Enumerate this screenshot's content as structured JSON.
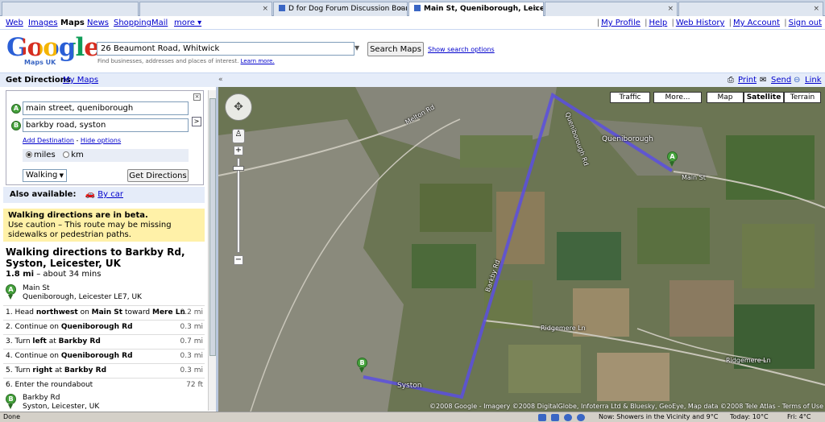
{
  "browser": {
    "tabs": [
      {
        "label": ""
      },
      {
        "label": ""
      },
      {
        "label": "D for Dog Forum Discussion Boar..."
      },
      {
        "label": "Main St, Queniborough, Leicest..."
      },
      {
        "label": ""
      },
      {
        "label": ""
      }
    ],
    "close_glyph": "×"
  },
  "gbar": {
    "left": [
      "Web",
      "Images",
      "Maps",
      "News",
      "Shopping",
      "Mail",
      "more ▾"
    ],
    "active": "Maps",
    "right": [
      "My Profile",
      "Help",
      "Web History",
      "My Account",
      "Sign out"
    ]
  },
  "header": {
    "logo_text": "Google",
    "logo_sub": "Maps UK",
    "search_value": "26 Beaumont Road, Whitwick",
    "search_button": "Search Maps",
    "show_options": "Show search options",
    "hint": "Find businesses, addresses and places of interest.",
    "hint_link": "Learn more."
  },
  "dirbar": {
    "title": "Get Directions",
    "my_maps": "My Maps",
    "collapse": "«",
    "print": "Print",
    "send": "Send",
    "link": "Link"
  },
  "directions": {
    "from_marker": "A",
    "to_marker": "B",
    "from_value": "main street, queniborough",
    "to_value": "barkby road, syston",
    "add_destination": "Add Destination",
    "separator": " - ",
    "hide_options": "Hide options",
    "unit_miles": "miles",
    "unit_km": "km",
    "mode": "Walking",
    "get_button": "Get Directions",
    "reverse": ">",
    "close": "×"
  },
  "also": {
    "label": "Also available:",
    "by_car": "By car"
  },
  "warning": {
    "title": "Walking directions are in beta.",
    "body": "Use caution – This route may be missing sidewalks or pedestrian paths."
  },
  "route": {
    "title": "Walking directions to Barkby Rd, Syston, Leicester, UK",
    "distance": "1.8 mi",
    "duration": " – about 34 mins",
    "start_line1": "Main St",
    "start_line2": "Queniborough, Leicester LE7, UK",
    "end_line1": "Barkby Rd",
    "end_line2": "Syston, Leicester, UK"
  },
  "steps": [
    {
      "n": "1.",
      "pre": "Head ",
      "b1": "northwest",
      "mid": " on ",
      "b2": "Main St",
      "post": " toward ",
      "b3": "Mere Ln",
      "dist": "0.2 mi"
    },
    {
      "n": "2.",
      "pre": "Continue on ",
      "b1": "Queniborough Rd",
      "mid": "",
      "b2": "",
      "post": "",
      "b3": "",
      "dist": "0.3 mi"
    },
    {
      "n": "3.",
      "pre": "Turn ",
      "b1": "left",
      "mid": " at ",
      "b2": "Barkby Rd",
      "post": "",
      "b3": "",
      "dist": "0.7 mi"
    },
    {
      "n": "4.",
      "pre": "Continue on ",
      "b1": "Queniborough Rd",
      "mid": "",
      "b2": "",
      "post": "",
      "b3": "",
      "dist": "0.3 mi"
    },
    {
      "n": "5.",
      "pre": "Turn ",
      "b1": "right",
      "mid": " at ",
      "b2": "Barkby Rd",
      "post": "",
      "b3": "",
      "dist": "0.3 mi"
    },
    {
      "n": "6.",
      "pre": "Enter the roundabout",
      "b1": "",
      "mid": "",
      "b2": "",
      "post": "",
      "b3": "",
      "dist": "72 ft"
    }
  ],
  "map": {
    "buttons": [
      "Traffic",
      "More...",
      "Map",
      "Satellite",
      "Terrain"
    ],
    "selected": "Satellite",
    "labels": {
      "queniborough": "Queniborough",
      "syston": "Syston",
      "barkby": "Barkby Rd",
      "ridgemere": "Ridgemere Ln",
      "ridgemere2": "Ridgemere Ln",
      "main_st": "Main St",
      "queniborough_rd": "Queniborough Rd",
      "melton_rd": "Melton Rd"
    },
    "copyright": "©2008 Google - Imagery ©2008 DigitalGlobe, Infoterra Ltd & Bluesky, GeoEye, Map data ©2008 Tele Atlas - Terms of Use",
    "route_color": "#5b4fe0"
  },
  "status": {
    "done": "Done",
    "weather": "Now: Showers in the Vicinity and 9°C",
    "today": "Today: 10°C",
    "fri": "Fri: 4°C"
  }
}
